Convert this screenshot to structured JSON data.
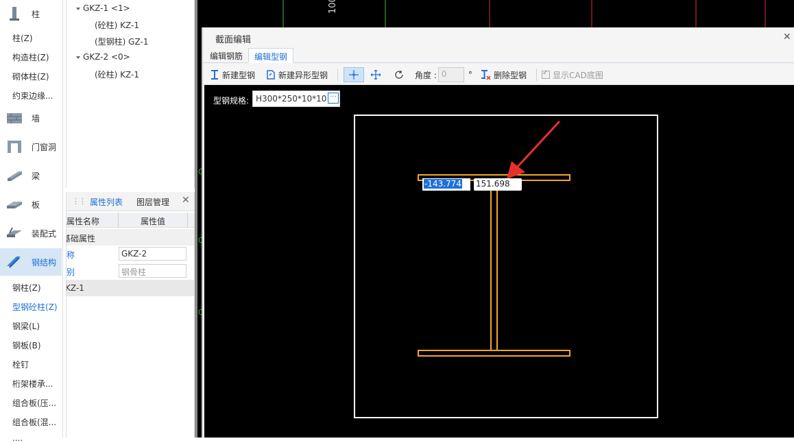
{
  "left_panel": {
    "categories": [
      {
        "label": "柱",
        "icon": "column-icon"
      },
      {
        "label": "墙",
        "icon": "wall-icon"
      },
      {
        "label": "门窗洞",
        "icon": "door-window-icon"
      },
      {
        "label": "梁",
        "icon": "beam-icon"
      },
      {
        "label": "板",
        "icon": "slab-icon"
      },
      {
        "label": "装配式",
        "icon": "prefab-icon"
      },
      {
        "label": "钢结构",
        "icon": "steel-structure-icon"
      }
    ],
    "column_items": [
      "柱(Z)",
      "构造柱(Z)",
      "砌体柱(Z)",
      "约束边缘..."
    ],
    "steel_items": [
      "钢柱(Z)",
      "型钢砼柱(Z)",
      "钢梁(L)",
      "钢板(B)",
      "栓钉",
      "桁架楼承...",
      "组合板(压...",
      "组合板(混...",
      "...."
    ]
  },
  "tree": {
    "nodes": [
      {
        "label": "GKZ-1 <1>",
        "type": "parent"
      },
      {
        "label": "(砼柱) KZ-1",
        "type": "child"
      },
      {
        "label": "(型钢柱) GZ-1",
        "type": "child"
      },
      {
        "label": "GKZ-2 <0>",
        "type": "parent"
      },
      {
        "label": "(砼柱) KZ-1",
        "type": "child"
      }
    ]
  },
  "properties": {
    "tabs": [
      "属性列表",
      "图层管理"
    ],
    "headers": [
      "属性名称",
      "属性值"
    ],
    "group": "基础属性",
    "rows": [
      {
        "name": "称",
        "value": "GKZ-2"
      },
      {
        "name": "别",
        "value": "钢骨柱"
      }
    ],
    "footer_row": "KZ-1"
  },
  "canvas_bg": {
    "tick_label": "100"
  },
  "dialog": {
    "title": "截面编辑",
    "tabs": [
      "编辑钢筋",
      "编辑型钢"
    ],
    "toolbar": {
      "new_steel": "新建型钢",
      "new_custom_steel": "新建异形型钢",
      "angle_label": "角度 :",
      "angle_value": "0",
      "angle_unit": "°",
      "delete_steel": "删除型钢",
      "show_cad": "显示CAD底图"
    },
    "spec_label": "型钢规格:",
    "spec_value": "H300*250*10*10",
    "coord_x": "-143.774",
    "coord_y": "151.698"
  },
  "colors": {
    "accent": "#1e6fd9",
    "steel_outline": "#f5a623",
    "arrow": "#e8302a"
  }
}
